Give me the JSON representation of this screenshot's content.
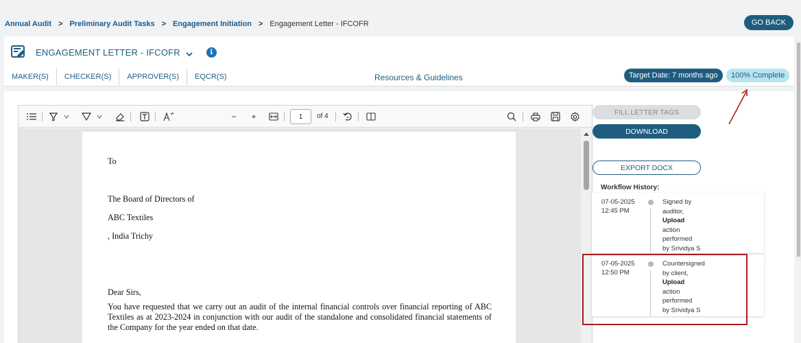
{
  "breadcrumb": {
    "items": [
      "Annual Audit",
      "Preliminary Audit Tasks",
      "Engagement Initiation"
    ],
    "current": "Engagement Letter - IFCOFR",
    "separator": ">"
  },
  "go_back_label": "GO BACK",
  "header": {
    "title": "ENGAGEMENT LETTER - IFCOFR",
    "info_glyph": "i",
    "tabs": [
      "MAKER(S)",
      "CHECKER(S)",
      "APPROVER(S)",
      "EQCR(S)"
    ],
    "resources_link": "Resources & Guidelines",
    "target_date": "Target Date: 7 months ago",
    "completion": "100% Complete"
  },
  "viewer": {
    "page_number": "1",
    "page_total": "of 4",
    "icons": [
      "outline-icon",
      "highlight-icon",
      "draw-icon",
      "eraser-icon",
      "text-box-icon",
      "read-aloud-icon",
      "zoom-out-icon",
      "zoom-in-icon",
      "fit-width-icon",
      "rotate-icon",
      "page-view-icon",
      "search-icon",
      "print-icon",
      "save-icon",
      "settings-icon"
    ],
    "zoom_out_glyph": "−",
    "zoom_in_glyph": "+",
    "letter": {
      "salutation_to": "To",
      "addressee": "The Board of Directors of",
      "company": "ABC Textiles",
      "location": ", India Trichy",
      "greeting": "Dear Sirs,",
      "paragraph": "You have requested that we carry out an audit of the internal financial controls over financial reporting of ABC Textiles as at 2023-2024 in conjunction with our audit of the standalone and consolidated financial statements of the Company for the year ended on that date."
    }
  },
  "actions": {
    "fill_tags": "FILL LETTER TAGS",
    "download": "DOWNLOAD",
    "export": "EXPORT DOCX"
  },
  "workflow": {
    "title": "Workflow History:",
    "entries": [
      {
        "date": "07-05-2025",
        "time": "12:45 PM",
        "line1": "Signed by",
        "line2": "auditor,",
        "action": "Upload",
        "line4": "action",
        "line5": "performed",
        "line6": "by Srividya S"
      },
      {
        "date": "07-05-2025",
        "time": "12:50 PM",
        "line1": "Countersigned",
        "line2": "by client,",
        "action": "Upload",
        "line4": "action",
        "line5": "performed",
        "line6": "by Srividya S"
      }
    ]
  },
  "colors": {
    "primary": "#1e5d80",
    "badge_light": "#b6e4ef",
    "annotation_red": "#a81e1e"
  }
}
